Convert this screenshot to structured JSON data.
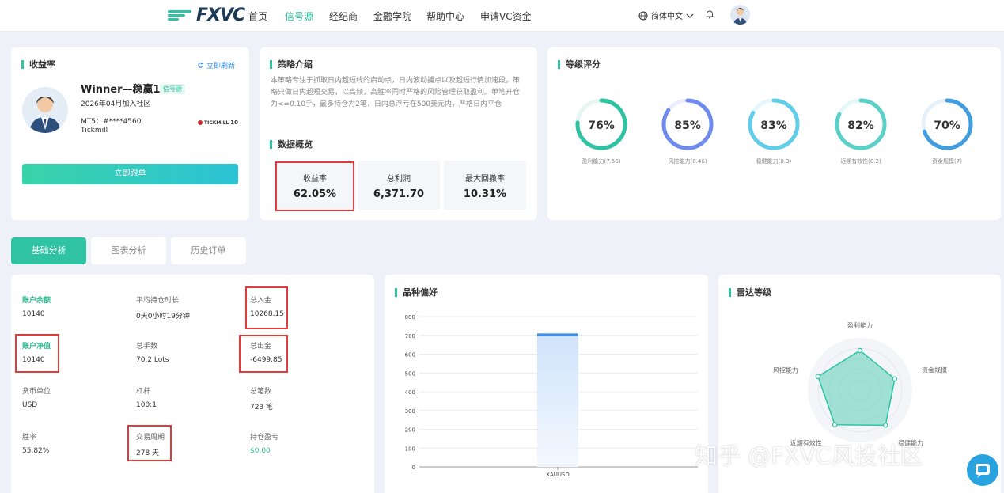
{
  "nav": {
    "logo_text": "FXVC",
    "items": [
      "首页",
      "信号源",
      "经纪商",
      "金融学院",
      "帮助中心",
      "申请VC资金"
    ],
    "active_index": 1,
    "language": "简体中文"
  },
  "profile": {
    "section_title": "收益率",
    "refresh_label": "立即刷新",
    "name": "Winner—稳赢1号",
    "tag": "信号源",
    "joined": "2026年04月加入社区",
    "mt5": "MT5：#****4560",
    "broker": "Tickmill",
    "broker_logo_text": "TICKMILL",
    "broker_logo_suffix": "10",
    "follow_button": "立即跟单"
  },
  "strategy": {
    "title": "策略介绍",
    "text": "本策略专注于抓取日内超短线的启动点，日内波动捕点以及超短行情加速段。策略只做日内超短交易，以高频，高胜率同时严格的风险管理获取盈利。单笔开仓为<=0.10手，最多持仓为2笔，日内总浮亏在500美元内，严格日内平仓",
    "overview_title": "数据概览",
    "stats": [
      {
        "label": "收益率",
        "value": "62.05%"
      },
      {
        "label": "总利润",
        "value": "6,371.70"
      },
      {
        "label": "最大回撤率",
        "value": "10.31%"
      }
    ]
  },
  "ratings": {
    "title": "等级评分",
    "items": [
      {
        "percent": 76,
        "display": "76%",
        "label": "盈利能力(7.58)",
        "color": "#2fc3a3",
        "track": "#e6f6f1"
      },
      {
        "percent": 85,
        "display": "85%",
        "label": "风控能力(8.46)",
        "color": "#6f8bf0",
        "track": "#e9edfc"
      },
      {
        "percent": 83,
        "display": "83%",
        "label": "稳健能力(8.3)",
        "color": "#62cde8",
        "track": "#e6f7fb"
      },
      {
        "percent": 82,
        "display": "82%",
        "label": "近期有效性(8.2)",
        "color": "#5ad1c8",
        "track": "#e5f7f6"
      },
      {
        "percent": 70,
        "display": "70%",
        "label": "资金规模(7)",
        "color": "#3f9de0",
        "track": "#e6f0fa"
      }
    ]
  },
  "tabs": [
    "基础分析",
    "图表分析",
    "历史订单"
  ],
  "basic": {
    "rows": [
      [
        {
          "label": "账户余额",
          "value": "10140",
          "highlight": true
        },
        {
          "label": "平均持仓时长",
          "value": "0天0小时19分钟"
        },
        {
          "label": "总入金",
          "value": "10268.15"
        }
      ],
      [
        {
          "label": "账户净值",
          "value": "10140",
          "highlight": true
        },
        {
          "label": "总手数",
          "value": "70.2 Lots"
        },
        {
          "label": "总出金",
          "value": "-6499.85"
        }
      ],
      [
        {
          "label": "货币单位",
          "value": "USD"
        },
        {
          "label": "杠杆",
          "value": "100:1"
        },
        {
          "label": "总笔数",
          "value": "723 笔"
        }
      ],
      [
        {
          "label": "胜率",
          "value": "55.82%"
        },
        {
          "label": "交易周期",
          "value": "278 天"
        },
        {
          "label": "持仓盈亏",
          "value": "$0.00",
          "green_value": true
        }
      ]
    ]
  },
  "chart_data": [
    {
      "type": "bar",
      "title": "品种偏好",
      "categories": [
        "XAUUSD"
      ],
      "values": [
        710
      ],
      "ylim": [
        0,
        800
      ],
      "yticks": [
        "800",
        "700",
        "600",
        "500",
        "400",
        "300",
        "200",
        "100",
        "0"
      ],
      "grid": true
    }
  ],
  "radar": {
    "title": "雷达等级",
    "axes": [
      "盈利能力",
      "资金规模",
      "稳健能力",
      "近期有效性",
      "风控能力"
    ],
    "values": [
      7.58,
      7,
      8.3,
      8.2,
      8.46
    ],
    "max": 10
  },
  "watermark": "知乎 @FXVC风投社区"
}
